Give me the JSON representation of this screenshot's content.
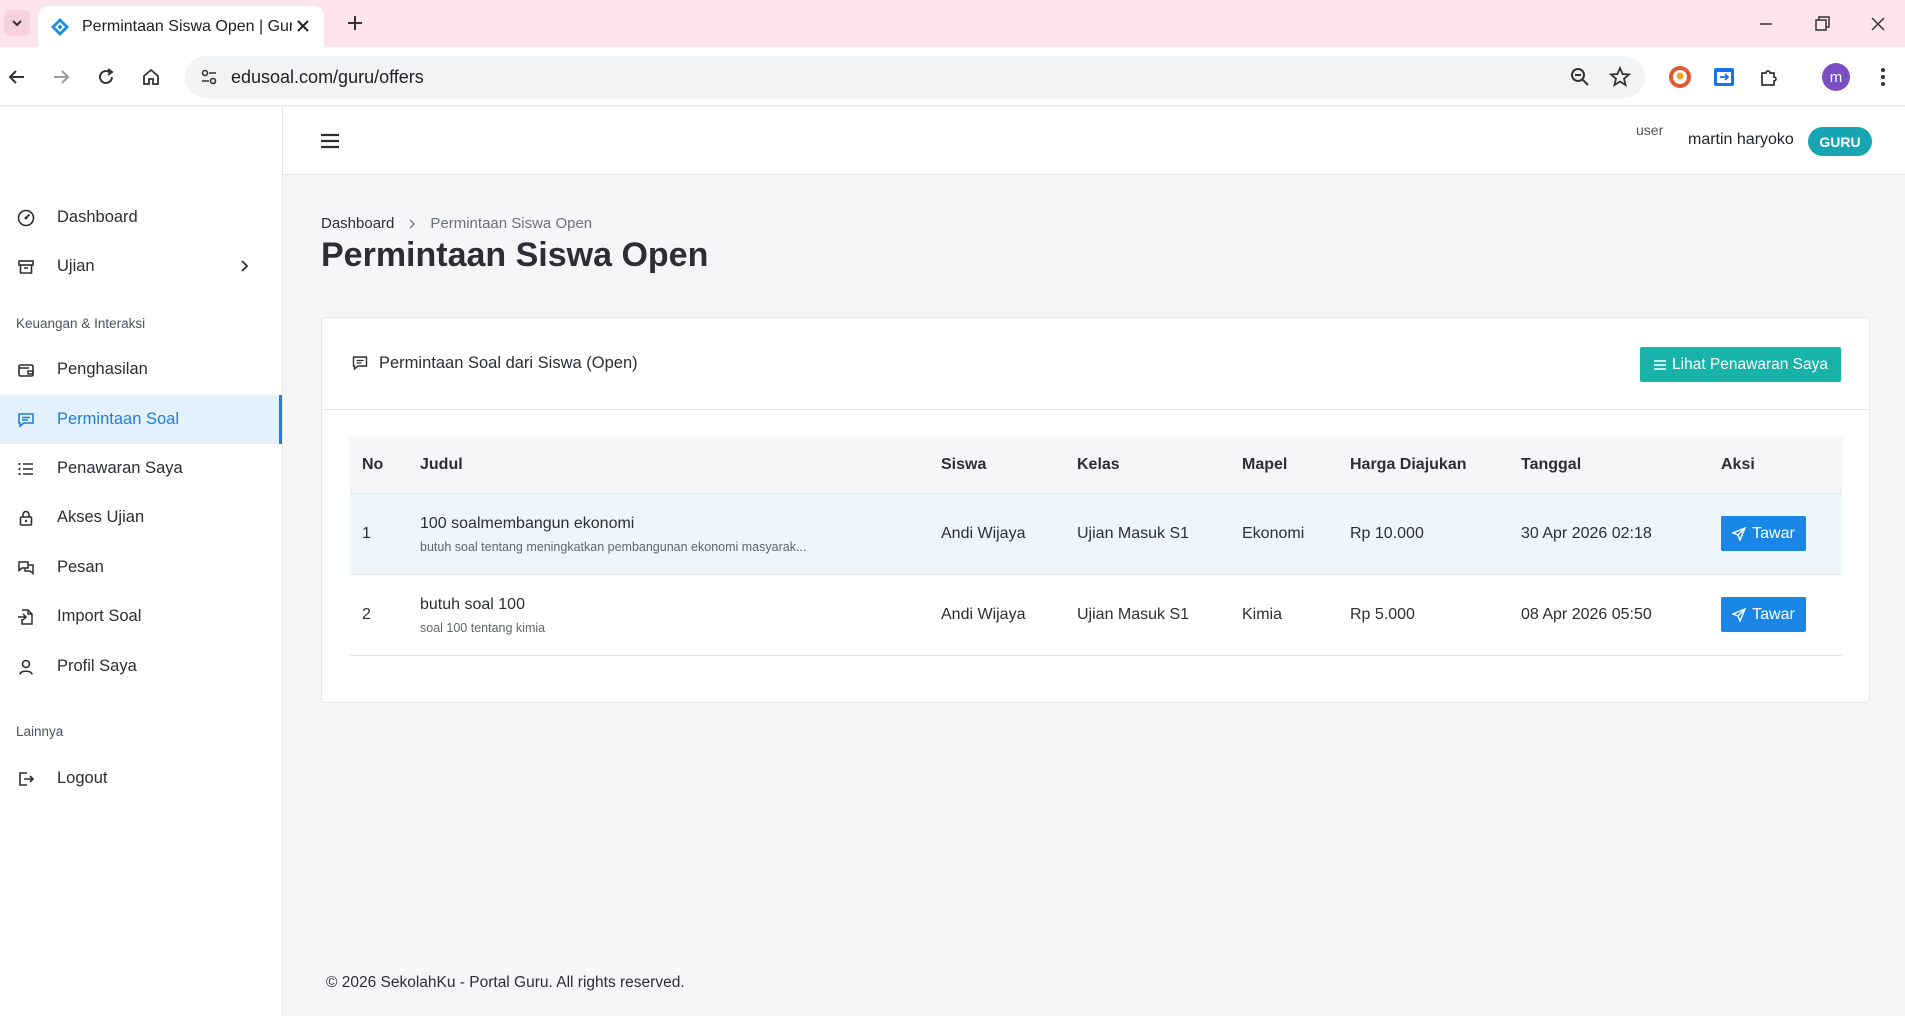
{
  "browser": {
    "tab_title": "Permintaan Siswa Open | Guru S",
    "url": "edusoal.com/guru/offers",
    "profile_initial": "m"
  },
  "sidebar": {
    "items": [
      {
        "label": "Dashboard",
        "icon": "gauge-icon"
      },
      {
        "label": "Ujian",
        "icon": "archive-icon"
      }
    ],
    "section_finance": "Keuangan & Interaksi",
    "finance_items": [
      {
        "label": "Penghasilan",
        "icon": "wallet-icon"
      },
      {
        "label": "Permintaan Soal",
        "icon": "chat-icon",
        "active": true
      },
      {
        "label": "Penawaran Saya",
        "icon": "list-icon"
      },
      {
        "label": "Akses Ujian",
        "icon": "lock-icon"
      },
      {
        "label": "Pesan",
        "icon": "messages-icon"
      },
      {
        "label": "Import Soal",
        "icon": "file-import-icon"
      },
      {
        "label": "Profil Saya",
        "icon": "user-icon"
      }
    ],
    "section_other": "Lainnya",
    "other_items": [
      {
        "label": "Logout",
        "icon": "logout-icon"
      }
    ]
  },
  "header": {
    "avatar_alt": "user",
    "user_name": "martin haryoko",
    "role": "GURU"
  },
  "breadcrumb": {
    "home": "Dashboard",
    "current": "Permintaan Siswa Open"
  },
  "page_title": "Permintaan Siswa Open",
  "card": {
    "title": "Permintaan Soal dari Siswa (Open)",
    "action_label": "Lihat Penawaran Saya"
  },
  "table": {
    "headers": [
      "No",
      "Judul",
      "Siswa",
      "Kelas",
      "Mapel",
      "Harga Diajukan",
      "Tanggal",
      "Aksi"
    ],
    "rows": [
      {
        "no": "1",
        "title": "100 soalmembangun ekonomi",
        "desc": "butuh soal tentang meningkatkan pembangunan ekonomi masyarak...",
        "siswa": "Andi Wijaya",
        "kelas": "Ujian Masuk S1",
        "mapel": "Ekonomi",
        "harga": "Rp 10.000",
        "tanggal": "30 Apr 2026 02:18",
        "action": "Tawar"
      },
      {
        "no": "2",
        "title": "butuh soal 100",
        "desc": "soal 100 tentang kimia",
        "siswa": "Andi Wijaya",
        "kelas": "Ujian Masuk S1",
        "mapel": "Kimia",
        "harga": "Rp 5.000",
        "tanggal": "08 Apr 2026 05:50",
        "action": "Tawar"
      }
    ]
  },
  "footer": "© 2026 SekolahKu - Portal Guru. All rights reserved."
}
